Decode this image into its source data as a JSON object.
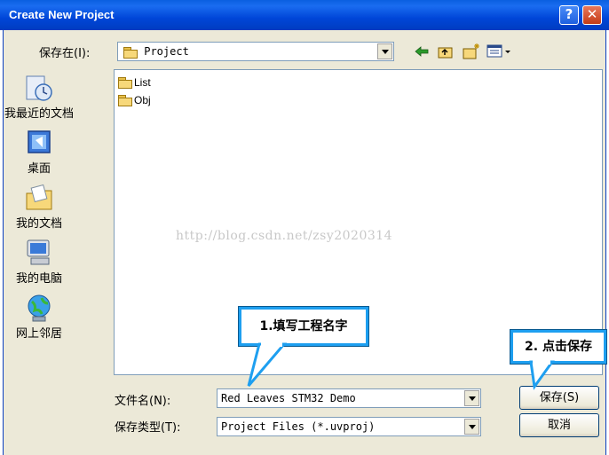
{
  "window": {
    "title": "Create New Project",
    "help_glyph": "?",
    "close_glyph": "✕"
  },
  "save_in": {
    "label": "保存在(I):",
    "value": "Project"
  },
  "places": [
    {
      "label": "我最近的文档",
      "icon": "recent-documents-icon"
    },
    {
      "label": "桌面",
      "icon": "desktop-icon"
    },
    {
      "label": "我的文档",
      "icon": "my-documents-icon"
    },
    {
      "label": "我的电脑",
      "icon": "my-computer-icon"
    },
    {
      "label": "网上邻居",
      "icon": "network-places-icon"
    }
  ],
  "files": [
    {
      "name": "List"
    },
    {
      "name": "Obj"
    }
  ],
  "watermark": "http://blog.csdn.net/zsy2020314",
  "filename": {
    "label": "文件名(N):",
    "value": "Red Leaves STM32 Demo"
  },
  "filetype": {
    "label": "保存类型(T):",
    "value": "Project Files (*.uvproj)"
  },
  "buttons": {
    "save": "保存(S)",
    "cancel": "取消"
  },
  "callouts": {
    "name_hint": "1.填写工程名字",
    "save_hint": "2. 点击保存"
  },
  "colors": {
    "titlebar": "#0046d8",
    "callout_border": "#1e9ff0",
    "dialog_bg": "#ece9d8"
  }
}
